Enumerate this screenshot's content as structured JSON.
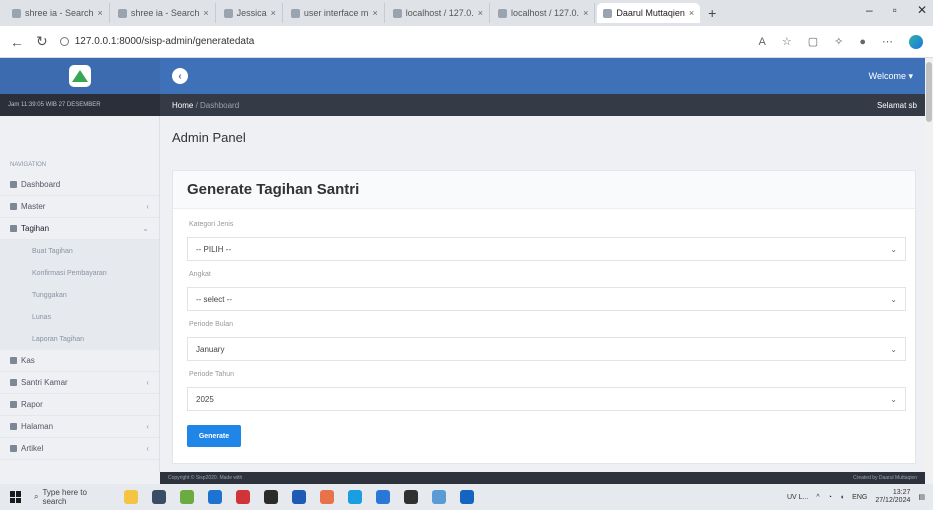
{
  "browser": {
    "tabs": [
      {
        "label": "shree ia - Search"
      },
      {
        "label": "shree ia - Search"
      },
      {
        "label": "Jessica"
      },
      {
        "label": "user interface m"
      },
      {
        "label": "localhost / 127.0."
      },
      {
        "label": "localhost / 127.0."
      },
      {
        "label": "Daarul Muttaqien",
        "active": true
      }
    ],
    "url": "127.0.0.1:8000/sisp-admin/generatedata"
  },
  "app": {
    "user_menu": "Welcome ▾",
    "sidebar_head": "Jam 11:39:05 WIB 27 DESEMBER",
    "breadcrumb_home": "Home",
    "breadcrumb_current": "Dashboard",
    "breadcrumb_right": "Selamat sb"
  },
  "sidebar": {
    "section_label": "NAVIGATION",
    "items": [
      {
        "label": "Dashboard",
        "caret": false
      },
      {
        "label": "Master",
        "caret": true
      },
      {
        "label": "Tagihan",
        "caret": true,
        "open": true
      }
    ],
    "sub_items": [
      {
        "label": "Buat Tagihan"
      },
      {
        "label": "Konfirmasi Pembayaran"
      },
      {
        "label": "Tunggakan"
      },
      {
        "label": "Lunas"
      },
      {
        "label": "Laporan Tagihan"
      }
    ],
    "items_after": [
      {
        "label": "Kas",
        "caret": false
      },
      {
        "label": "Santri Kamar",
        "caret": true
      },
      {
        "label": "Rapor",
        "caret": false
      },
      {
        "label": "Halaman",
        "caret": true
      },
      {
        "label": "Artikel",
        "caret": true
      }
    ]
  },
  "main": {
    "page_title": "Admin Panel",
    "card_title": "Generate Tagihan Santri",
    "fields": [
      {
        "label": "Kategori Jenis",
        "value": "-- PILIH --"
      },
      {
        "label": "Angkat",
        "value": "-- select --"
      },
      {
        "label": "Periode Bulan",
        "value": "January"
      },
      {
        "label": "Periode Tahun",
        "value": "2025"
      }
    ],
    "generate_label": "Generate"
  },
  "footer": {
    "left": "Copyright © Sisp2020. Made with",
    "right": "Created by Daarul Muttaqien"
  },
  "taskbar": {
    "search_placeholder": "Type here to search",
    "weather": "UV L...",
    "time": "13:27",
    "date": "27/12/2024",
    "lang": "ENG"
  }
}
